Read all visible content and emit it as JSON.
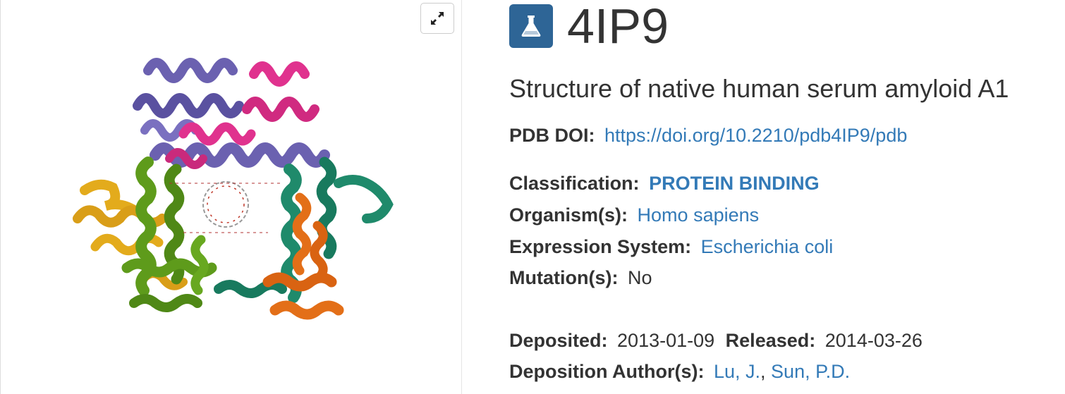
{
  "entry": {
    "id": "4IP9",
    "title": "Structure of native human serum amyloid A1",
    "icon": "flask-icon"
  },
  "viewer": {
    "expand_icon": "expand-arrows-icon",
    "chain_colors": [
      "#6b61b0",
      "#e0328e",
      "#1f8a6b",
      "#e36f18",
      "#5e9b1b",
      "#e3ab1c"
    ]
  },
  "details": {
    "pdb_doi": {
      "label": "PDB DOI:",
      "value": "https://doi.org/10.2210/pdb4IP9/pdb"
    },
    "classification": {
      "label": "Classification:",
      "value": "PROTEIN BINDING"
    },
    "organism": {
      "label": "Organism(s):",
      "value": "Homo sapiens"
    },
    "expression_system": {
      "label": "Expression System:",
      "value": "Escherichia coli"
    },
    "mutation": {
      "label": "Mutation(s):",
      "value": "No"
    },
    "deposited": {
      "label": "Deposited:",
      "value": "2013-01-09"
    },
    "released": {
      "label": "Released:",
      "value": "2014-03-26"
    },
    "authors": {
      "label": "Deposition Author(s):",
      "values": [
        "Lu, J.",
        "Sun, P.D."
      ]
    }
  },
  "colors": {
    "link": "#337ab7",
    "badge": "#2e6596",
    "text": "#333333"
  }
}
